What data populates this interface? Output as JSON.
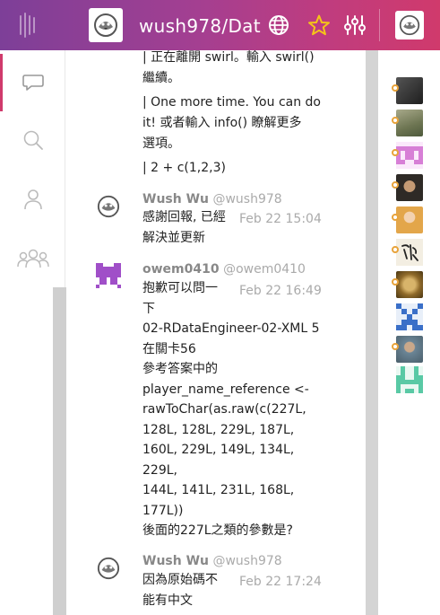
{
  "header": {
    "room_title": "wush978/Dat",
    "icons": [
      "menu-icon",
      "room-avatar",
      "globe-icon",
      "star-icon",
      "settings-sliders-icon",
      "user-avatar"
    ],
    "colors": {
      "gradient_start": "#7d3f98",
      "gradient_end": "#d03a6c",
      "star": "#f5c518"
    }
  },
  "nav": {
    "items": [
      {
        "icon": "chat-bubble-icon",
        "active": true
      },
      {
        "icon": "search-icon",
        "active": false
      },
      {
        "icon": "person-icon",
        "active": false
      },
      {
        "icon": "people-icon",
        "active": false
      }
    ],
    "accent": "#d03a6c"
  },
  "chat": {
    "continuation_lines": [
      "| 正在離開 swirl。輸入 swirl()",
      "繼續。",
      "",
      "| One more time. You can do",
      "it! 或者輸入 info() 瞭解更多",
      "選項。",
      "",
      "| 2 + c(1,2,3)"
    ],
    "messages": [
      {
        "display_name": "Wush Wu",
        "username": "@wush978",
        "time": "Feb 22 15:04",
        "avatar": "bird-avatar",
        "lines": [
          "感謝回報, 已經",
          "解決並更新"
        ]
      },
      {
        "display_name": "owem0410",
        "username": "@owem0410",
        "time": "Feb 22 16:49",
        "avatar": "purple-identicon",
        "lines": [
          "抱歉可以問一",
          "下",
          "02-RDataEngineer-02-XML 5",
          "在關卡56",
          "參考答案中的",
          "player_name_reference <-",
          "rawToChar(as.raw(c(227L,",
          "128L, 128L, 229L, 187L,",
          "160L, 229L, 149L, 134L,",
          "229L,",
          "144L, 141L, 231L, 168L,",
          "177L))",
          "後面的227L之類的參數是?"
        ]
      },
      {
        "display_name": "Wush Wu",
        "username": "@wush978",
        "time": "Feb 22 17:24",
        "avatar": "bird-avatar",
        "lines": [
          "因為原始碼不",
          "能有中文"
        ]
      }
    ]
  },
  "roster": {
    "members": [
      {
        "avatar": "photo-avatar-1",
        "color": "#3a3a3a"
      },
      {
        "avatar": "photo-avatar-2",
        "color": "#7d8560"
      },
      {
        "avatar": "identicon-pink",
        "color": "#d77fd6"
      },
      {
        "avatar": "photo-avatar-3",
        "color": "#2e2a26"
      },
      {
        "avatar": "photo-avatar-4",
        "color": "#e3a64a"
      },
      {
        "avatar": "calligraphy-avatar",
        "color": "#f3eee2"
      },
      {
        "avatar": "painting-avatar",
        "color": "#8f6a2a"
      },
      {
        "avatar": "identicon-blue",
        "color": "#3a6fc8"
      },
      {
        "avatar": "photo-avatar-5",
        "color": "#6b8596"
      },
      {
        "avatar": "identicon-green",
        "color": "#59c9a5"
      }
    ],
    "presence_color": "#e8a33a"
  }
}
